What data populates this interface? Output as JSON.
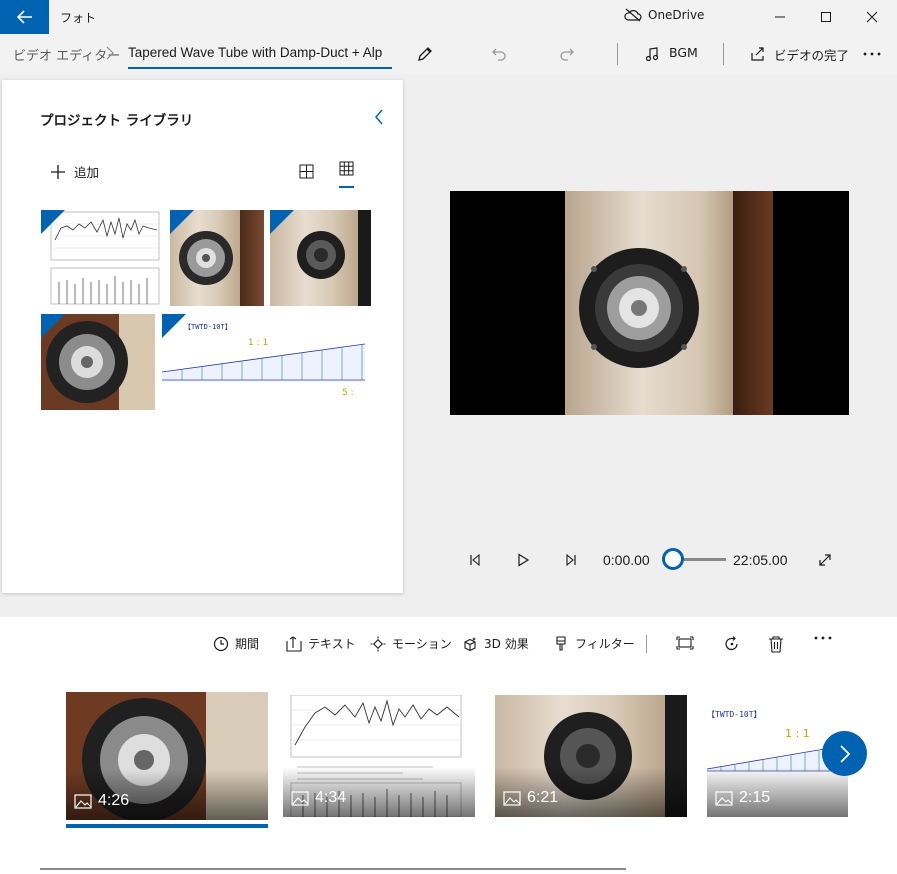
{
  "app": {
    "title": "フォト",
    "onedrive_label": "OneDrive"
  },
  "breadcrumb": {
    "root": "ビデオ エディター",
    "project_name": "Tapered Wave Tube with Damp-Duct + Alp"
  },
  "toolbar": {
    "bgm_label": "BGM",
    "finish_label": "ビデオの完了"
  },
  "library": {
    "title": "プロジェクト ライブラリ",
    "add_label": "追加"
  },
  "thumb_art": {
    "diagram_label": "【TWTD-10T】",
    "ratio_label": "1 : 1",
    "ratio2_label": "5 :"
  },
  "playback": {
    "current_time": "0:00.00",
    "total_time": "22:05.00",
    "progress": 0
  },
  "storyboard": {
    "tools": {
      "duration": "期間",
      "text": "テキスト",
      "motion": "モーション",
      "effects3d": "3D 効果",
      "filters": "フィルター"
    },
    "clips": [
      {
        "duration": "4:26"
      },
      {
        "duration": "4:34"
      },
      {
        "duration": "6:21"
      },
      {
        "duration": "2:15"
      }
    ]
  },
  "colors": {
    "accent": "#0063b1"
  }
}
